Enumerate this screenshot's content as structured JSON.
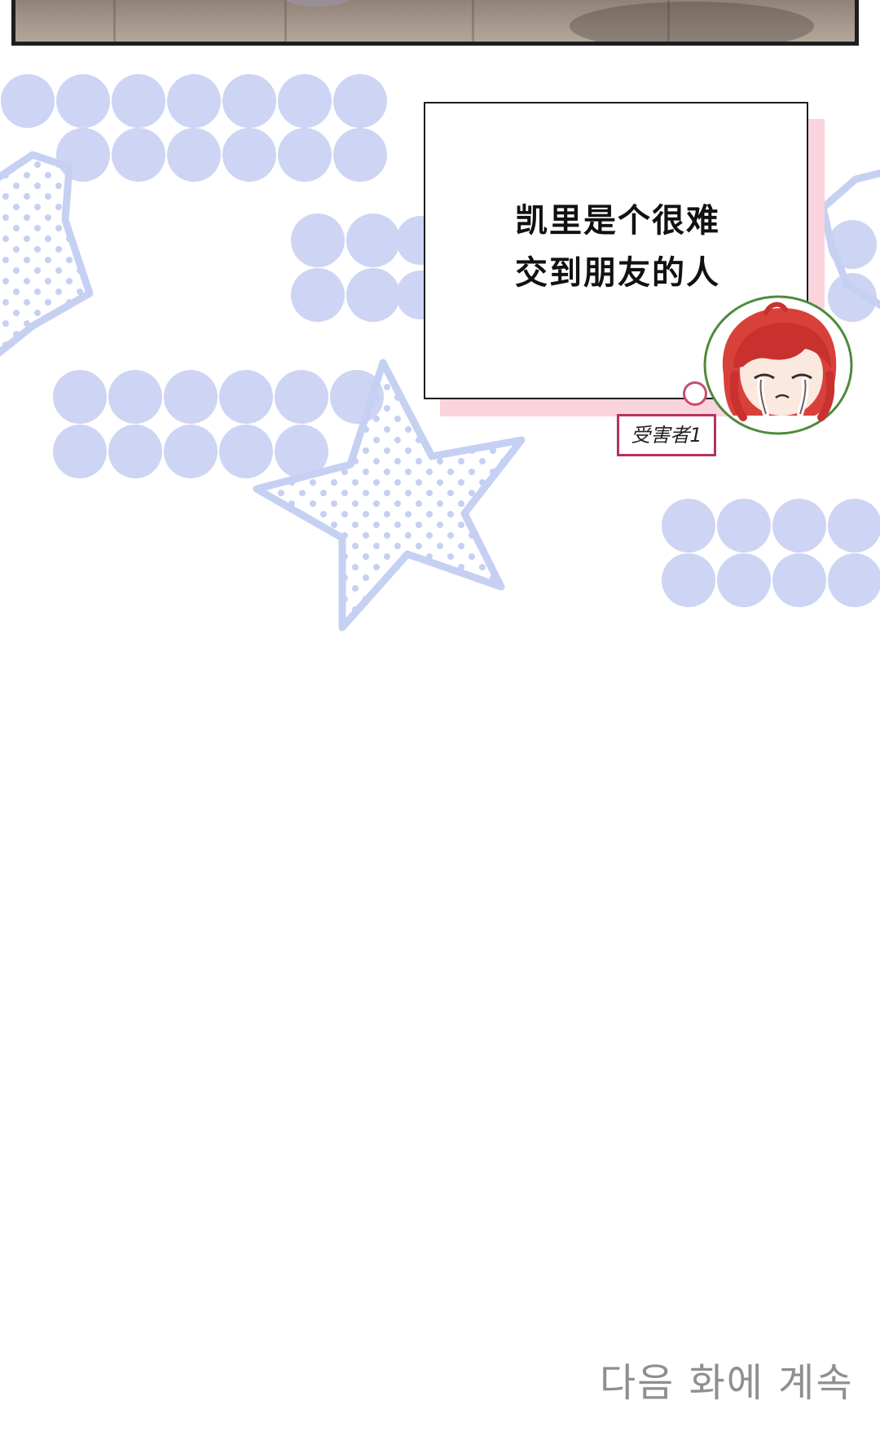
{
  "panel": {
    "narration_lines": [
      "凯里是个很难",
      "交到朋友的人"
    ],
    "name_tag": "受害者1"
  },
  "footer": {
    "continue_text": "다음 화에 계속"
  },
  "icons": {
    "character": "red-haired-crying-chibi-icon",
    "decoration": [
      "lavender-dot-pattern",
      "star-outline-dotted"
    ]
  },
  "colors": {
    "dot_lavender": "#cdd4f4",
    "star_blue": "#c6d0f2",
    "box_shadow_pink": "#f9d4dd",
    "tag_border": "#b8325a",
    "hair_red": "#d8413a",
    "footer_gray": "#8f8f8f"
  }
}
